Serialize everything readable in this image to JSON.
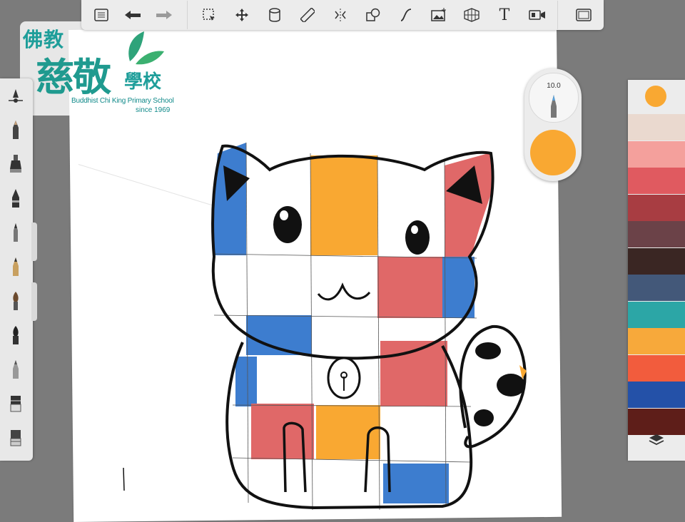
{
  "toolbar": {
    "items": [
      "menu-icon",
      "undo-icon",
      "redo-icon",
      "select-icon",
      "transform-icon",
      "fill-icon",
      "ruler-icon",
      "symmetry-icon",
      "shape-icon",
      "curve-icon",
      "image-icon",
      "perspective-icon",
      "text-icon",
      "video-icon",
      "fullscreen-icon"
    ]
  },
  "brush_puck": {
    "size": "10.0",
    "color": "#f9a832"
  },
  "palette": {
    "current": "#f9a832",
    "swatches": [
      "#ead9cf",
      "#f4a09c",
      "#e05a60",
      "#a83d42",
      "#6b4248",
      "#3a2623",
      "#435879",
      "#2ca6a6",
      "#f7a93b",
      "#f25c3d",
      "#2451a8",
      "#5e1e19"
    ]
  },
  "logo": {
    "line1": "佛教",
    "line2": "慈敬",
    "line3": "學校",
    "english": "Buddhist Chi King Primary School",
    "since": "since 1969"
  },
  "brushes": [
    "pencil",
    "airbrush",
    "marker",
    "pen",
    "fineliner",
    "paintbrush",
    "ink-brush",
    "chisel",
    "eraser-soft",
    "eraser-hard",
    "smudge"
  ]
}
